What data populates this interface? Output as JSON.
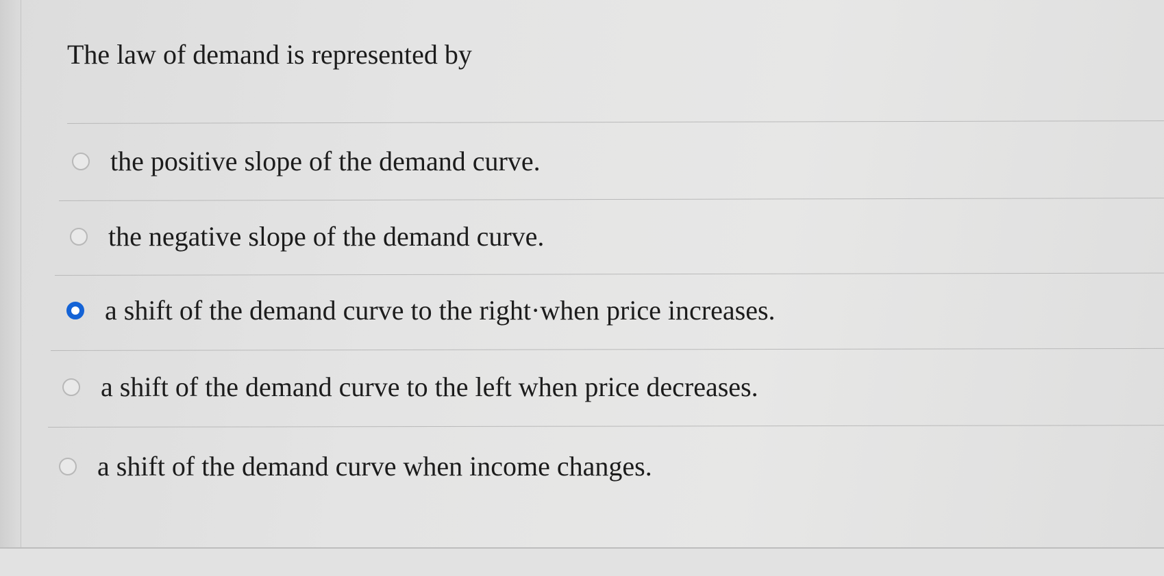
{
  "question": {
    "text": "The law of demand is represented by"
  },
  "options": [
    {
      "label": "the positive slope of the demand curve.",
      "selected": false
    },
    {
      "label": "the negative slope of the demand curve.",
      "selected": false
    },
    {
      "label": "a shift of the demand curve to the right·when price increases.",
      "selected": true
    },
    {
      "label": "a shift of the demand curve to the left when price decreases.",
      "selected": false
    },
    {
      "label": "a shift of the demand curve when income changes.",
      "selected": false
    }
  ],
  "colors": {
    "selected_radio": "#1463d6",
    "unselected_radio_border": "#b8b8b8",
    "text": "#1c1c1c"
  }
}
